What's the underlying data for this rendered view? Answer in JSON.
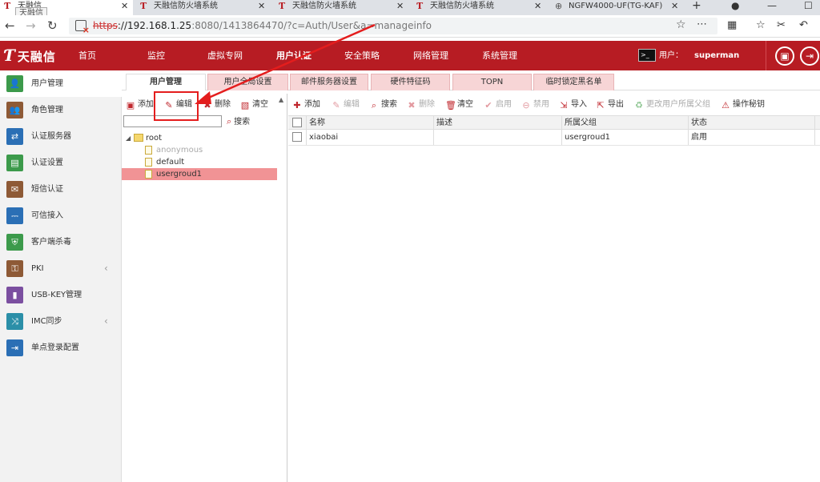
{
  "browser": {
    "tabs": [
      {
        "title": "天融信",
        "active": true
      },
      {
        "title": "天融信防火墙系统",
        "active": false
      },
      {
        "title": "天融信防火墙系统",
        "active": false
      },
      {
        "title": "天融信防火墙系统",
        "active": false
      },
      {
        "title": "NGFW4000-UF(TG-KAF)",
        "active": false
      }
    ],
    "tooltip": "天融信",
    "url": {
      "protocol": "https",
      "host": "://192.168.1.25",
      "rest": ":8080/1413864470/?c=Auth/User&a=manageinfo"
    }
  },
  "app": {
    "logo_text": "天融信",
    "logo_mark": "Ƭ",
    "nav": [
      "首页",
      "监控",
      "虚拟专网",
      "用户认证",
      "安全策略",
      "网络管理",
      "系统管理"
    ],
    "active_nav": "用户认证",
    "user_label": "用户：",
    "username": "superman"
  },
  "sidebar": {
    "items": [
      {
        "label": "用户管理",
        "icon": "user-icon",
        "color": "#3c9a4b",
        "glyph": "👤",
        "active": true
      },
      {
        "label": "角色管理",
        "icon": "role-icon",
        "color": "#8e5a36",
        "glyph": "👥",
        "active": false
      },
      {
        "label": "认证服务器",
        "icon": "server-icon",
        "color": "#2b6fb5",
        "glyph": "⇄",
        "active": false
      },
      {
        "label": "认证设置",
        "icon": "settings-doc-icon",
        "color": "#3c9a4b",
        "glyph": "▤",
        "active": false
      },
      {
        "label": "短信认证",
        "icon": "sms-icon",
        "color": "#8e5a36",
        "glyph": "✉",
        "active": false
      },
      {
        "label": "可信接入",
        "icon": "plug-icon",
        "color": "#2b6fb5",
        "glyph": "⎓",
        "active": false
      },
      {
        "label": "客户端杀毒",
        "icon": "shield-icon",
        "color": "#3c9a4b",
        "glyph": "⛨",
        "active": false
      },
      {
        "label": "PKI",
        "icon": "pki-icon",
        "color": "#8e5a36",
        "glyph": "⚿",
        "active": false,
        "chevron": true
      },
      {
        "label": "USB-KEY管理",
        "icon": "usb-key-icon",
        "color": "#7b4fa0",
        "glyph": "▮",
        "active": false
      },
      {
        "label": "IMC同步",
        "icon": "sync-icon",
        "color": "#2b8fa8",
        "glyph": "⤨",
        "active": false,
        "chevron": true
      },
      {
        "label": "单点登录配置",
        "icon": "sso-icon",
        "color": "#2b6fb5",
        "glyph": "⇥",
        "active": false
      }
    ],
    "chevron_glyph": "‹"
  },
  "content_tabs": [
    "用户管理",
    "用户全局设置",
    "邮件服务器设置",
    "硬件特征码",
    "TOPN",
    "临时锁定黑名单"
  ],
  "tree_panel": {
    "toolbar": [
      {
        "label": "添加",
        "icon": "add-group-icon",
        "glyph": "▣",
        "disabled": false
      },
      {
        "label": "编辑",
        "icon": "edit-icon",
        "glyph": "✎",
        "disabled": false
      },
      {
        "label": "删除",
        "icon": "delete-icon",
        "glyph": "✖",
        "disabled": false
      },
      {
        "label": "清空",
        "icon": "clear-icon",
        "glyph": "▧",
        "disabled": false
      }
    ],
    "search_placeholder": "",
    "search_label": "搜索",
    "tree": [
      {
        "label": "root",
        "level": 0,
        "type": "folder",
        "expanded": true
      },
      {
        "label": "anonymous",
        "level": 1,
        "type": "file",
        "muted": true
      },
      {
        "label": "default",
        "level": 1,
        "type": "file"
      },
      {
        "label": "usergroud1",
        "level": 1,
        "type": "file",
        "selected": true
      }
    ]
  },
  "grid_panel": {
    "toolbar": [
      {
        "label": "添加",
        "icon": "add-icon",
        "glyph": "✚",
        "color": "#c0282e",
        "disabled": false
      },
      {
        "label": "编辑",
        "icon": "edit-icon",
        "glyph": "✎",
        "color": "#e39aa0",
        "disabled": true
      },
      {
        "label": "搜索",
        "icon": "search-icon",
        "glyph": "⌕",
        "color": "#c0282e",
        "disabled": false
      },
      {
        "label": "删除",
        "icon": "delete-icon",
        "glyph": "✖",
        "color": "#e39aa0",
        "disabled": true
      },
      {
        "label": "清空",
        "icon": "trash-icon",
        "glyph": "🗑",
        "color": "#c0282e",
        "disabled": false
      },
      {
        "label": "启用",
        "icon": "enable-icon",
        "glyph": "✔",
        "color": "#e39aa0",
        "disabled": true
      },
      {
        "label": "禁用",
        "icon": "disable-icon",
        "glyph": "⊖",
        "color": "#e39aa0",
        "disabled": true
      },
      {
        "label": "导入",
        "icon": "import-icon",
        "glyph": "⇲",
        "color": "#c0282e",
        "disabled": false
      },
      {
        "label": "导出",
        "icon": "export-icon",
        "glyph": "⇱",
        "color": "#c0282e",
        "disabled": false
      },
      {
        "label": "更改用户所属父组",
        "icon": "change-group-icon",
        "glyph": "♻",
        "color": "#8bc48f",
        "disabled": true
      },
      {
        "label": "操作秘钥",
        "icon": "key-icon",
        "glyph": "⚠",
        "color": "#c0282e",
        "disabled": false
      }
    ],
    "columns": [
      "名称",
      "描述",
      "所属父组",
      "状态"
    ],
    "rows": [
      {
        "name": "xiaobai",
        "desc": "",
        "parent": "usergroud1",
        "status": "启用"
      }
    ]
  },
  "colors": {
    "brand_red": "#b71c23",
    "selected_row": "#f19395",
    "tab_inactive": "#f7d5d6",
    "annotation": "#e41d1d"
  }
}
